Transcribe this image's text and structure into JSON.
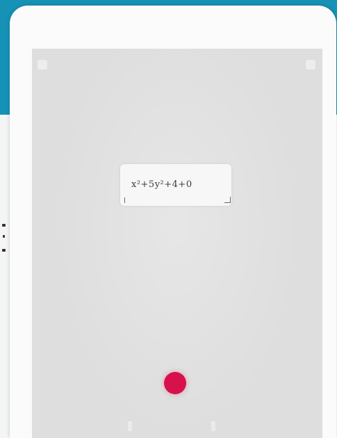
{
  "equation": {
    "text": "x²+5y²+4+0"
  },
  "icons": {
    "capture": "capture-icon",
    "crop": "crop-icon"
  },
  "colors": {
    "header": "#1592b6",
    "capture_button": "#d6114c",
    "screen": "#dedede"
  }
}
